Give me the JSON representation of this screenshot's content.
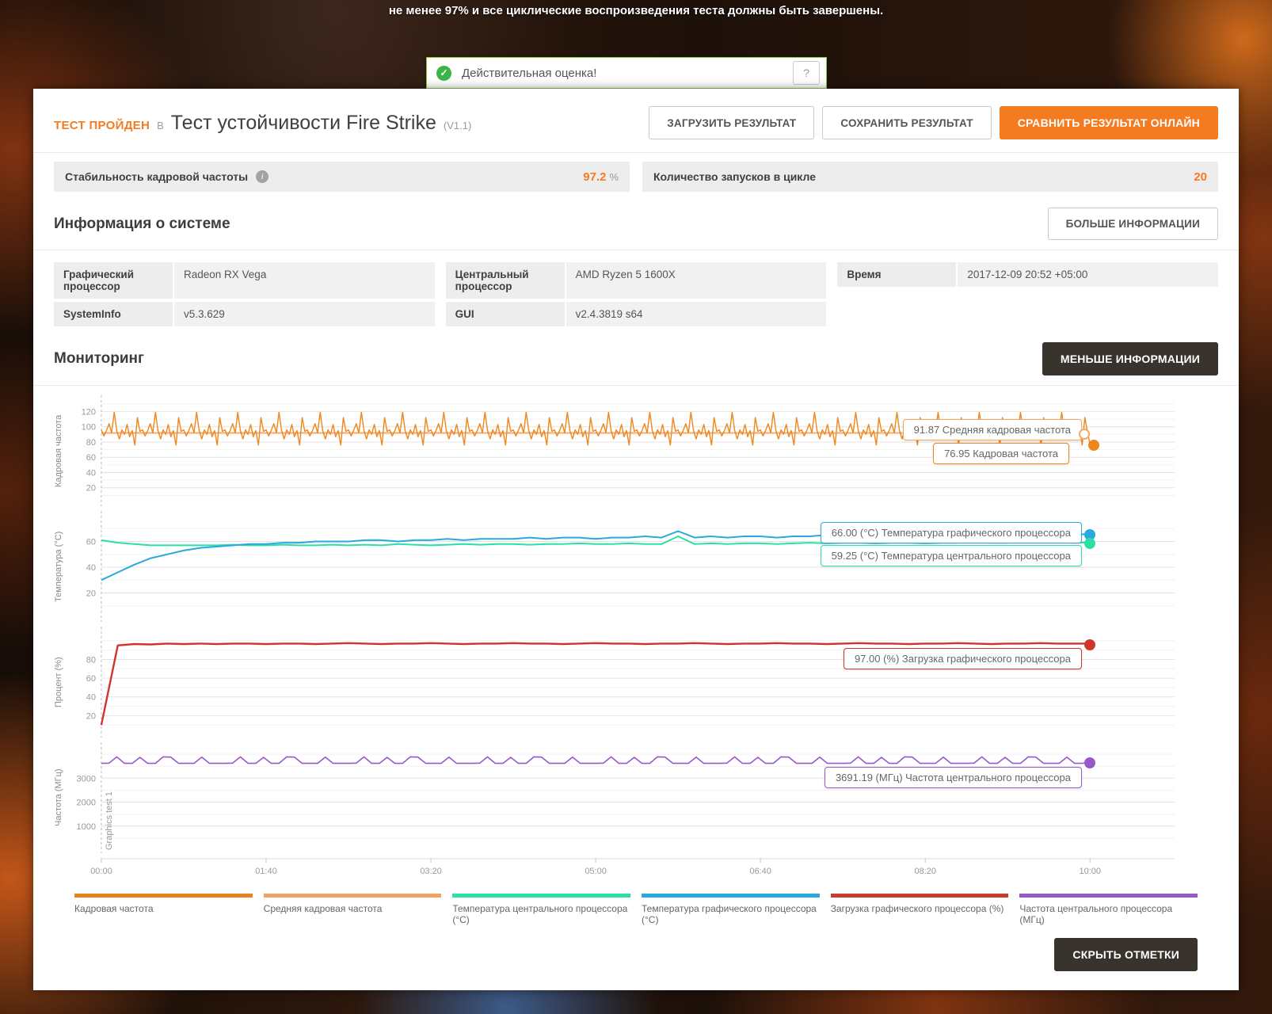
{
  "page": {
    "top_note": "не менее 97% и все циклические воспроизведения теста должны быть завершены.",
    "alert": {
      "check_icon": "✓",
      "text": "Действительная оценка!",
      "help_label": "?"
    }
  },
  "header": {
    "status": "ТЕСТ ПРОЙДЕН",
    "connector": "В",
    "title": "Тест устойчивости Fire Strike",
    "version": "(V1.1)",
    "buttons": {
      "load": "ЗАГРУЗИТЬ РЕЗУЛЬТАТ",
      "save": "СОХРАНИТЬ РЕЗУЛЬТАТ",
      "compare": "СРАВНИТЬ РЕЗУЛЬТАТ ОНЛАЙН"
    }
  },
  "stats": {
    "left_label": "Стабильность кадровой частоты",
    "info_icon": "i",
    "left_value": "97.2",
    "left_unit": "%",
    "right_label": "Количество запусков в цикле",
    "right_value": "20"
  },
  "system_info": {
    "heading": "Информация о системе",
    "more_button": "БОЛЬШЕ ИНФОРМАЦИИ",
    "gpu_label": "Графический процессор",
    "gpu_value": "Radeon RX Vega",
    "sysinfo_label": "SystemInfo",
    "sysinfo_value": "v5.3.629",
    "cpu_label": "Центральный процессор",
    "cpu_value": "AMD Ryzen 5 1600X",
    "gui_label": "GUI",
    "gui_value": "v2.4.3819 s64",
    "time_label": "Время",
    "time_value": "2017-12-09 20:52 +05:00"
  },
  "monitoring": {
    "heading": "Мониторинг",
    "less_button": "МЕНЬШЕ ИНФОРМАЦИИ",
    "hide_marks_button": "СКРЫТЬ ОТМЕТКИ"
  },
  "chart_data": {
    "type": "line",
    "x_domain_seconds": [
      0,
      600
    ],
    "xtick_labels": [
      "00:00",
      "01:40",
      "03:20",
      "05:00",
      "06:40",
      "08:20",
      "10:00"
    ],
    "charts": [
      {
        "ylabel": "Кадровая частота",
        "ylim": [
          0,
          135
        ],
        "yticks": [
          20,
          40,
          60,
          80,
          100,
          120
        ],
        "ytick_step": 20,
        "series": [
          {
            "name": "Средняя кадровая частота",
            "color": "#f5a863",
            "width": 1.8,
            "pattern": [
              92,
              91.8,
              92.1,
              91.9
            ],
            "repeat": 96,
            "last_value": 91.87
          },
          {
            "name": "Кадровая частота",
            "color": "#f0861e",
            "width": 1.4,
            "pattern": [
              96,
              88,
              95,
              104,
              92,
              119,
              95,
              84,
              96,
              90,
              103,
              87,
              95,
              76,
              112,
              94
            ],
            "repeat": 24,
            "last_value": 76.95
          }
        ],
        "tooltips": [
          {
            "value": 91.87,
            "text": "91.87 Средняя кадровая частота"
          },
          {
            "value": 76.95,
            "text": "76.95 Кадровая частота"
          }
        ]
      },
      {
        "ylabel": "Температура (°C)",
        "ylim": [
          0,
          80
        ],
        "yticks": [
          20,
          40,
          60
        ],
        "ytick_step": 20,
        "series": [
          {
            "name": "Температура центрального процессора (°C)",
            "color": "#2be0a8",
            "width": 2,
            "values": [
              61,
              59,
              58,
              57,
              57,
              57,
              57,
              57,
              57.5,
              57,
              57,
              57.5,
              57,
              57,
              57.5,
              57,
              57.5,
              57,
              58,
              57.5,
              57,
              57.5,
              58,
              57.5,
              58,
              58,
              57.5,
              58,
              58,
              58.5,
              58,
              58,
              58.5,
              58,
              58,
              64,
              58,
              58.5,
              58,
              58.5,
              58.5,
              58,
              58.5,
              59,
              58.5,
              59,
              59,
              58.5,
              59,
              59,
              58.5,
              59,
              59,
              59.5,
              59,
              59,
              59.5,
              59,
              59.5,
              59,
              59.25
            ]
          },
          {
            "name": "Температура графического процессора (°C)",
            "color": "#29a9e0",
            "width": 2,
            "values": [
              30,
              36,
              42,
              47,
              50,
              53,
              55,
              56,
              57,
              58,
              58,
              59,
              59,
              60,
              60,
              60,
              61,
              61,
              60,
              61,
              61,
              62,
              61,
              62,
              62,
              62,
              63,
              62,
              63,
              63,
              62,
              63,
              63,
              64,
              63,
              68,
              63,
              64,
              63,
              64,
              64,
              63,
              64,
              64,
              65,
              64,
              64,
              65,
              64,
              65,
              64,
              65,
              65,
              64,
              65,
              66,
              65,
              64,
              66,
              65,
              66
            ]
          }
        ],
        "tooltips": [
          {
            "value": 66.0,
            "text": "66.00 (°C) Температура графического процессора"
          },
          {
            "value": 59.25,
            "text": "59.25 (°C) Температура центрального процессора"
          }
        ]
      },
      {
        "ylabel": "Процент (%)",
        "ylim": [
          0,
          110
        ],
        "yticks": [
          20,
          40,
          60,
          80
        ],
        "ytick_step": 20,
        "series": [
          {
            "name": "Загрузка графического процессора (%)",
            "color": "#d0352c",
            "width": 2.4,
            "values": [
              10,
              95,
              96.5,
              96,
              97,
              96.5,
              97,
              96.5,
              97,
              97,
              96.5,
              97,
              97,
              96.5,
              97,
              97.5,
              97,
              96.5,
              97,
              97,
              97.5,
              97,
              96.5,
              97,
              97,
              97.5,
              97,
              97,
              96.5,
              97,
              97.5,
              97,
              97,
              96.5,
              97,
              97,
              97.5,
              97,
              96.5,
              97,
              97,
              97.5,
              97,
              97,
              96.5,
              97,
              97.5,
              97,
              97,
              96.5,
              97,
              97,
              97.5,
              97,
              96.5,
              97,
              97,
              97.5,
              97,
              97,
              97
            ]
          }
        ],
        "tooltips": [
          {
            "value": 97.0,
            "text": "97.00 (%) Загрузка графического процессора"
          }
        ]
      },
      {
        "ylabel": "Частота (МГц)",
        "ylim": [
          0,
          4300
        ],
        "yticks": [
          1000,
          2000,
          3000
        ],
        "ytick_step": 1000,
        "annotation": "Graphics test 1",
        "series": [
          {
            "name": "Частота центрального процессора (МГц)",
            "color": "#9659cb",
            "width": 1.6,
            "pattern": [
              3620,
              3630,
              3890,
              3620,
              3620,
              3870,
              3620,
              3620,
              3890,
              3880,
              3620,
              3620,
              3620,
              3880,
              3620,
              3620
            ],
            "repeat": 8,
            "last_value": 3691.19
          }
        ],
        "tooltips": [
          {
            "value": 3691.19,
            "text": "3691.19 (МГц) Частота центрального процессора"
          }
        ]
      }
    ],
    "legend": [
      {
        "label": "Кадровая частота",
        "color": "#e8821e"
      },
      {
        "label": "Средняя кадровая частота",
        "color": "#f2a263"
      },
      {
        "label": "Температура центрального процессора (°C)",
        "color": "#2be0a8"
      },
      {
        "label": "Температура графического процессора (°C)",
        "color": "#29a9e0"
      },
      {
        "label": "Загрузка графического процессора (%)",
        "color": "#c93a31"
      },
      {
        "label": "Частота центрального процессора (МГц)",
        "color": "#9659cb"
      }
    ]
  }
}
